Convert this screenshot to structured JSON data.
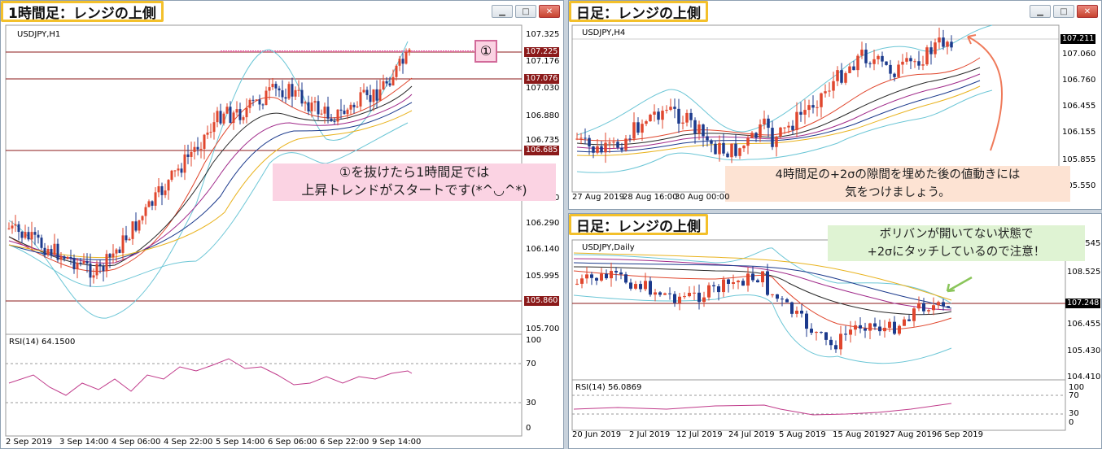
{
  "windows": {
    "h1": {
      "title": "1時間足：レンジの上側",
      "symbol": "USDJPY,H1",
      "price_axis": [
        "107.325",
        "107.225",
        "107.176",
        "107.076",
        "107.030",
        "106.880",
        "106.735",
        "106.685",
        "106.440",
        "106.290",
        "106.140",
        "105.995",
        "105.860",
        "105.700"
      ],
      "line_labels": [
        "107.225",
        "107.076",
        "106.685",
        "105.860"
      ],
      "circled_marker": "①",
      "annotation": [
        "①を抜けたら1時間足では",
        "上昇トレンドがスタートです(*^◡^*)"
      ],
      "rsi_label": "RSI(14) 64.1500",
      "rsi_axis": [
        "100",
        "70",
        "30",
        "0"
      ],
      "time_axis": [
        "2 Sep 2019",
        "3 Sep 14:00",
        "4 Sep 06:00",
        "4 Sep 22:00",
        "5 Sep 14:00",
        "6 Sep 06:00",
        "6 Sep 22:00",
        "9 Sep 14:00"
      ]
    },
    "h4": {
      "title": "日足：レンジの上側",
      "symbol": "USDJPY,H4",
      "price_axis": [
        "107.211",
        "107.060",
        "106.760",
        "106.455",
        "106.155",
        "105.855",
        "105.550"
      ],
      "annotation": [
        "4時間足の+2σの隙間を埋めた後の値動きには",
        "気をつけましょう。"
      ],
      "time_axis": [
        "27 Aug 2019",
        "28 Aug 16:00",
        "30 Aug 00:00"
      ]
    },
    "daily": {
      "title": "日足：レンジの上側",
      "symbol": "USDJPY,Daily",
      "price_axis": [
        "109.545",
        "108.525",
        "107.248",
        "106.455",
        "105.430",
        "104.410"
      ],
      "annotation": [
        "ボリバンが開いてない状態で",
        "+2σにタッチしているので注意！"
      ],
      "rsi_label": "RSI(14) 56.0869",
      "rsi_axis": [
        "100",
        "70",
        "30",
        "0"
      ],
      "time_axis": [
        "20 Jun 2019",
        "2 Jul 2019",
        "12 Jul 2019",
        "24 Jul 2019",
        "5 Aug 2019",
        "15 Aug 2019",
        "27 Aug 2019",
        "6 Sep 2019"
      ]
    }
  },
  "buttons": {
    "minimize": "▁",
    "maximize": "□",
    "close": "✕"
  },
  "colors": {
    "bull": "#e0472e",
    "bear": "#1c3a8c",
    "band": "#6cc6d6",
    "range_line": "#8b1a1a",
    "note_pink": "#fbd3e3",
    "note_peach": "#fde3d3",
    "note_green": "#dff3d3",
    "tag_border": "#f3c02b"
  }
}
